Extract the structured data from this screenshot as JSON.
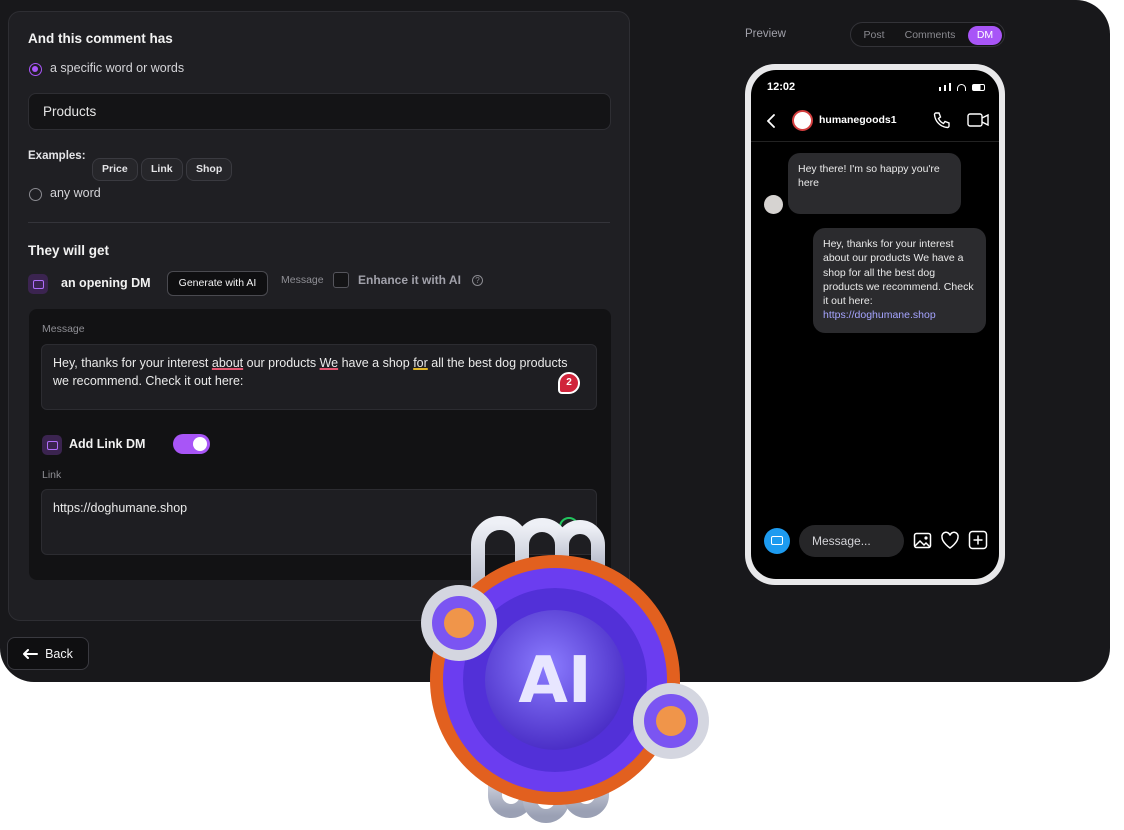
{
  "left_panel": {
    "comment_heading": "And this comment has",
    "option_specific": "a specific word or words",
    "keyword_value": "Products",
    "examples_label": "Examples:",
    "examples": [
      "Price",
      "Link",
      "Shop"
    ],
    "option_any": "any word",
    "they_get_heading": "They will get",
    "opening_dm_label": "an opening DM",
    "generate_button": "Generate with AI",
    "message_mini_label": "Message",
    "enhance_label": "Enhance it with AI",
    "message_label": "Message",
    "message_text": {
      "p1": "Hey, thanks for your interest ",
      "w1": "about",
      "p2": " our products ",
      "w2": "We",
      "p3": " have a shop ",
      "w3": "for",
      "p4": " all the best dog products we recommend. Check it out here:"
    },
    "error_count": "2",
    "add_link_label": "Add Link DM",
    "add_link_enabled": true,
    "link_label": "Link",
    "link_value": "https://doghumane.shop",
    "back_button": "Back"
  },
  "preview": {
    "label": "Preview",
    "tabs": [
      "Post",
      "Comments",
      "DM"
    ],
    "active_tab": "DM",
    "phone": {
      "time": "12:02",
      "username": "humanegoods1",
      "incoming": "Hey there! I'm so happy you're here",
      "outgoing_text": "Hey, thanks for your interest about our products We have a shop for all the best dog products we recommend. Check it out here:",
      "outgoing_link": "https://doghumane.shop",
      "composer_placeholder": "Message..."
    }
  },
  "badge_text": "AI",
  "colors": {
    "accent": "#a855f7",
    "panel_bg": "#1f1f23",
    "app_bg": "#18181b",
    "error_red": "#d0243b",
    "camera_blue": "#1d9bf0"
  },
  "icons": {
    "back": "arrow-left-icon",
    "dm": "message-square-icon",
    "help": "help-circle-icon",
    "phone_call": "phone-icon",
    "video": "video-icon",
    "camera": "camera-icon",
    "image": "image-icon",
    "heart": "heart-icon",
    "plus": "plus-square-icon"
  }
}
